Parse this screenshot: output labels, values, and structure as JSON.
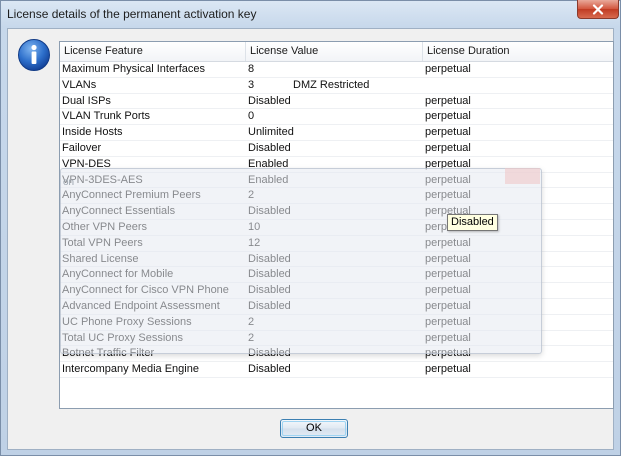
{
  "window": {
    "title": "License details of the permanent activation key"
  },
  "table": {
    "headers": [
      "License Feature",
      "License Value",
      "License Duration"
    ],
    "rows": [
      {
        "feature": "Maximum Physical Interfaces",
        "value": "8",
        "extra": "",
        "duration": "perpetual"
      },
      {
        "feature": "VLANs",
        "value": "3",
        "extra": "DMZ Restricted",
        "duration": ""
      },
      {
        "feature": "Dual ISPs",
        "value": "Disabled",
        "extra": "",
        "duration": "perpetual"
      },
      {
        "feature": "VLAN Trunk Ports",
        "value": "0",
        "extra": "",
        "duration": "perpetual"
      },
      {
        "feature": "Inside Hosts",
        "value": "Unlimited",
        "extra": "",
        "duration": "perpetual"
      },
      {
        "feature": "Failover",
        "value": "Disabled",
        "extra": "",
        "duration": "perpetual"
      },
      {
        "feature": "VPN-DES",
        "value": "Enabled",
        "extra": "",
        "duration": "perpetual"
      },
      {
        "feature": "VPN-3DES-AES",
        "value": "Enabled",
        "extra": "",
        "duration": "perpetual"
      },
      {
        "feature": "AnyConnect Premium Peers",
        "value": "2",
        "extra": "",
        "duration": "perpetual"
      },
      {
        "feature": "AnyConnect Essentials",
        "value": "Disabled",
        "extra": "",
        "duration": "perpetual"
      },
      {
        "feature": "Other VPN Peers",
        "value": "10",
        "extra": "",
        "duration": "perpetual"
      },
      {
        "feature": "Total VPN Peers",
        "value": "12",
        "extra": "",
        "duration": "perpetual"
      },
      {
        "feature": "Shared License",
        "value": "Disabled",
        "extra": "",
        "duration": "perpetual"
      },
      {
        "feature": "AnyConnect for Mobile",
        "value": "Disabled",
        "extra": "",
        "duration": "perpetual"
      },
      {
        "feature": "AnyConnect for Cisco VPN Phone",
        "value": "Disabled",
        "extra": "",
        "duration": "perpetual"
      },
      {
        "feature": "Advanced Endpoint Assessment",
        "value": "Disabled",
        "extra": "",
        "duration": "perpetual"
      },
      {
        "feature": "UC Phone Proxy Sessions",
        "value": "2",
        "extra": "",
        "duration": "perpetual"
      },
      {
        "feature": "Total UC Proxy Sessions",
        "value": "2",
        "extra": "",
        "duration": "perpetual"
      },
      {
        "feature": "Botnet Traffic Filter",
        "value": "Disabled",
        "extra": "",
        "duration": "perpetual"
      },
      {
        "feature": "Intercompany Media Engine",
        "value": "Disabled",
        "extra": "",
        "duration": "perpetual"
      }
    ]
  },
  "tooltip": {
    "text": "Disabled"
  },
  "overlay": {
    "text": "on"
  },
  "buttons": {
    "ok_label": "OK"
  },
  "icons": {
    "info": "info-icon",
    "close": "close-icon"
  }
}
